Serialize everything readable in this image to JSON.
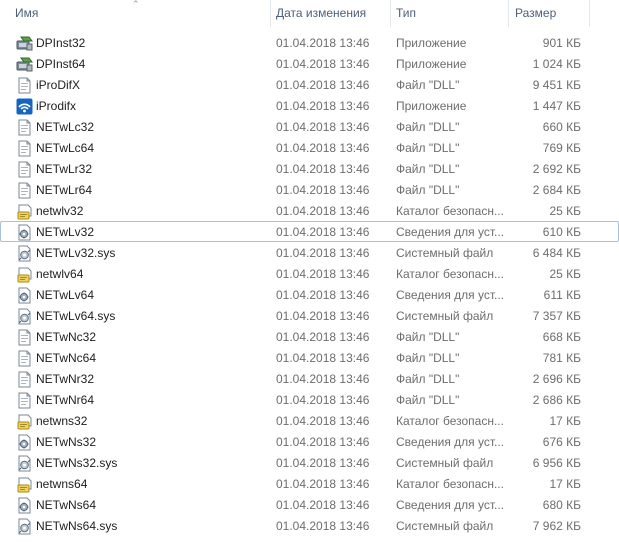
{
  "columns": {
    "name": "Имя",
    "date": "Дата изменения",
    "type": "Тип",
    "size": "Размер"
  },
  "files": [
    {
      "name": "DPInst32",
      "date": "01.04.2018 13:46",
      "type": "Приложение",
      "size": "901 КБ",
      "icon": "installer-icon"
    },
    {
      "name": "DPInst64",
      "date": "01.04.2018 13:46",
      "type": "Приложение",
      "size": "1 024 КБ",
      "icon": "installer-icon"
    },
    {
      "name": "iProDifX",
      "date": "01.04.2018 13:46",
      "type": "Файл \"DLL\"",
      "size": "9 451 КБ",
      "icon": "dll-icon"
    },
    {
      "name": "iProdifx",
      "date": "01.04.2018 13:46",
      "type": "Приложение",
      "size": "1 447 КБ",
      "icon": "wifi-app-icon"
    },
    {
      "name": "NETwLc32",
      "date": "01.04.2018 13:46",
      "type": "Файл \"DLL\"",
      "size": "660 КБ",
      "icon": "dll-icon"
    },
    {
      "name": "NETwLc64",
      "date": "01.04.2018 13:46",
      "type": "Файл \"DLL\"",
      "size": "769 КБ",
      "icon": "dll-icon"
    },
    {
      "name": "NETwLr32",
      "date": "01.04.2018 13:46",
      "type": "Файл \"DLL\"",
      "size": "2 692 КБ",
      "icon": "dll-icon"
    },
    {
      "name": "NETwLr64",
      "date": "01.04.2018 13:46",
      "type": "Файл \"DLL\"",
      "size": "2 684 КБ",
      "icon": "dll-icon"
    },
    {
      "name": "netwlv32",
      "date": "01.04.2018 13:46",
      "type": "Каталог безопасн...",
      "size": "25 КБ",
      "icon": "catalog-icon"
    },
    {
      "name": "NETwLv32",
      "date": "01.04.2018 13:46",
      "type": "Сведения для уст...",
      "size": "610 КБ",
      "icon": "inf-icon",
      "focused": true
    },
    {
      "name": "NETwLv32.sys",
      "date": "01.04.2018 13:46",
      "type": "Системный файл",
      "size": "6 484 КБ",
      "icon": "sys-icon"
    },
    {
      "name": "netwlv64",
      "date": "01.04.2018 13:46",
      "type": "Каталог безопасн...",
      "size": "25 КБ",
      "icon": "catalog-icon"
    },
    {
      "name": "NETwLv64",
      "date": "01.04.2018 13:46",
      "type": "Сведения для уст...",
      "size": "611 КБ",
      "icon": "inf-icon"
    },
    {
      "name": "NETwLv64.sys",
      "date": "01.04.2018 13:46",
      "type": "Системный файл",
      "size": "7 357 КБ",
      "icon": "sys-icon"
    },
    {
      "name": "NETwNc32",
      "date": "01.04.2018 13:46",
      "type": "Файл \"DLL\"",
      "size": "668 КБ",
      "icon": "dll-icon"
    },
    {
      "name": "NETwNc64",
      "date": "01.04.2018 13:46",
      "type": "Файл \"DLL\"",
      "size": "781 КБ",
      "icon": "dll-icon"
    },
    {
      "name": "NETwNr32",
      "date": "01.04.2018 13:46",
      "type": "Файл \"DLL\"",
      "size": "2 696 КБ",
      "icon": "dll-icon"
    },
    {
      "name": "NETwNr64",
      "date": "01.04.2018 13:46",
      "type": "Файл \"DLL\"",
      "size": "2 686 КБ",
      "icon": "dll-icon"
    },
    {
      "name": "netwns32",
      "date": "01.04.2018 13:46",
      "type": "Каталог безопасн...",
      "size": "17 КБ",
      "icon": "catalog-icon"
    },
    {
      "name": "NETwNs32",
      "date": "01.04.2018 13:46",
      "type": "Сведения для уст...",
      "size": "676 КБ",
      "icon": "inf-icon"
    },
    {
      "name": "NETwNs32.sys",
      "date": "01.04.2018 13:46",
      "type": "Системный файл",
      "size": "6 956 КБ",
      "icon": "sys-icon"
    },
    {
      "name": "netwns64",
      "date": "01.04.2018 13:46",
      "type": "Каталог безопасн...",
      "size": "17 КБ",
      "icon": "catalog-icon"
    },
    {
      "name": "NETwNs64",
      "date": "01.04.2018 13:46",
      "type": "Сведения для уст...",
      "size": "680 КБ",
      "icon": "inf-icon"
    },
    {
      "name": "NETwNs64.sys",
      "date": "01.04.2018 13:46",
      "type": "Системный файл",
      "size": "7 962 КБ",
      "icon": "sys-icon"
    }
  ]
}
